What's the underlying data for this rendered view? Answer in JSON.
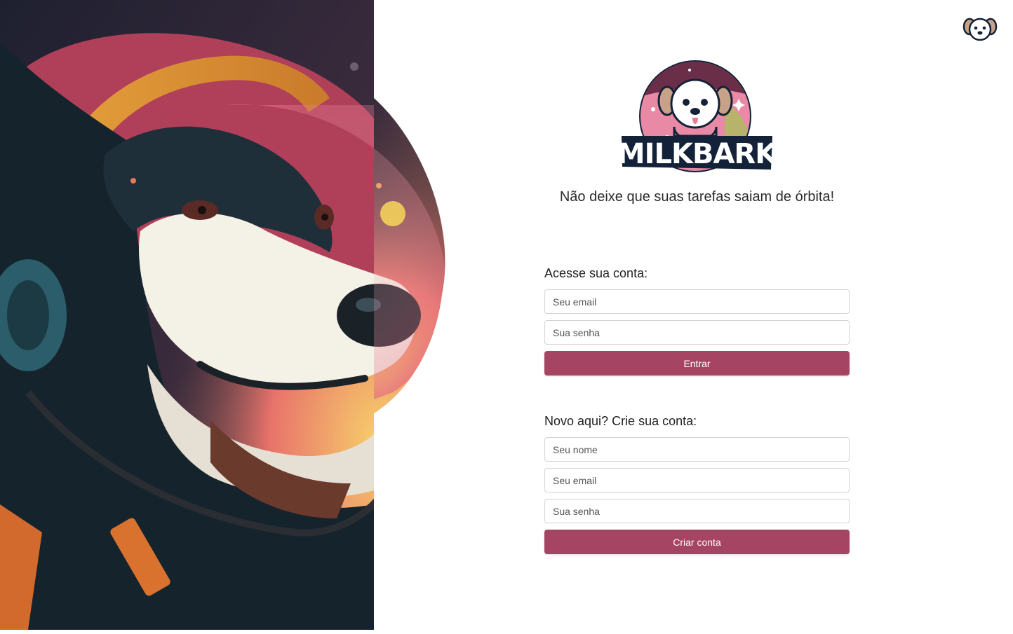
{
  "brand": {
    "logo_text": "MILKBARK",
    "accent_color": "#a64464",
    "navy_color": "#132238"
  },
  "tagline": "Não deixe que suas tarefas saiam de órbita!",
  "login": {
    "title": "Acesse sua conta:",
    "email_placeholder": "Seu email",
    "password_placeholder": "Sua senha",
    "submit_label": "Entrar"
  },
  "signup": {
    "title": "Novo aqui? Crie sua conta:",
    "name_placeholder": "Seu nome",
    "email_placeholder": "Seu email",
    "password_placeholder": "Sua senha",
    "submit_label": "Criar conta"
  },
  "icons": {
    "hero": "astronaut-dog-illustration",
    "corner": "dog-face-icon",
    "logo": "milkbark-logo"
  }
}
